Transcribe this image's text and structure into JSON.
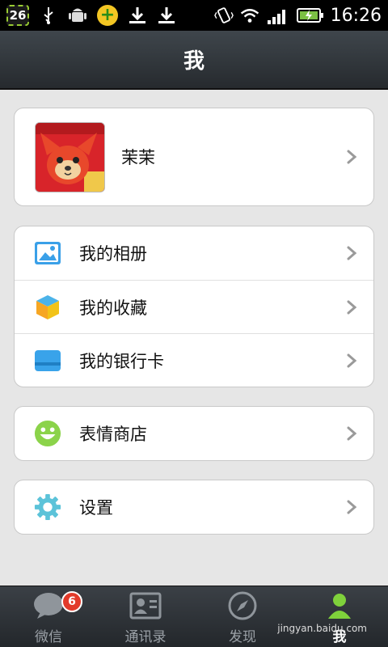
{
  "status_bar": {
    "notification_count": "26",
    "time": "16:26"
  },
  "header": {
    "title": "我"
  },
  "profile": {
    "name": "茉茉"
  },
  "menu_group_1": [
    {
      "label": "我的相册",
      "icon": "photo-album-icon"
    },
    {
      "label": "我的收藏",
      "icon": "favorites-cube-icon"
    },
    {
      "label": "我的银行卡",
      "icon": "bank-card-icon"
    }
  ],
  "menu_group_2": [
    {
      "label": "表情商店",
      "icon": "smiley-icon"
    }
  ],
  "menu_group_3": [
    {
      "label": "设置",
      "icon": "gear-icon"
    }
  ],
  "tabbar": {
    "tabs": [
      {
        "label": "微信",
        "badge": "6",
        "icon": "chat-bubble-icon"
      },
      {
        "label": "通讯录",
        "icon": "contacts-card-icon"
      },
      {
        "label": "发现",
        "icon": "compass-icon"
      },
      {
        "label": "我",
        "icon": "person-icon",
        "active": true
      }
    ]
  },
  "watermark": "jingyan.baidu.com",
  "colors": {
    "accent_green": "#8bd34a",
    "badge_red": "#e23a2a",
    "title_bar": "#2f3439"
  }
}
